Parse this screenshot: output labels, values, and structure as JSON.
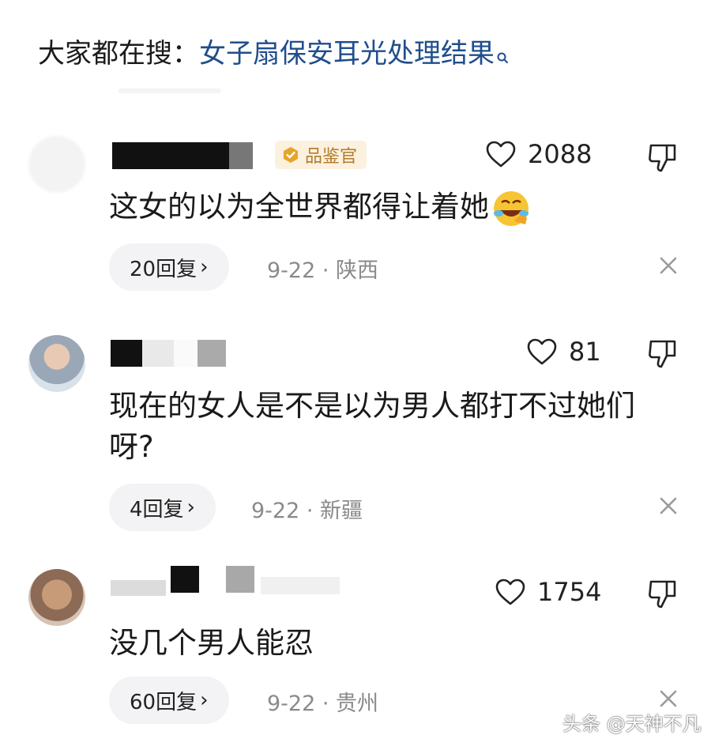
{
  "search": {
    "prefix": "大家都在搜：",
    "term": "女子扇保安耳光处理结果",
    "icon": "search-icon"
  },
  "comments": [
    {
      "badge": "品鉴官",
      "badge_icon": "official-badge-icon",
      "likes": "2088",
      "text": "这女的以为全世界都得让着她",
      "emoji": "laughing-emoji-icon",
      "replies": "20回复",
      "date_location": "9-22 · 陕西"
    },
    {
      "likes": "81",
      "text": "现在的女人是不是以为男人都打不过她们呀?",
      "replies": "4回复",
      "date_location": "9-22 · 新疆"
    },
    {
      "likes": "1754",
      "text": "没几个男人能忍",
      "replies": "60回复",
      "date_location": "9-22 · 贵州"
    }
  ],
  "watermark": "头条 @天神不凡",
  "colors": {
    "link": "#1f4e8c",
    "badge_bg": "#fbf1de",
    "badge_text": "#b27c2c",
    "meta": "#8a8a8a",
    "pill_bg": "#f3f3f5"
  }
}
